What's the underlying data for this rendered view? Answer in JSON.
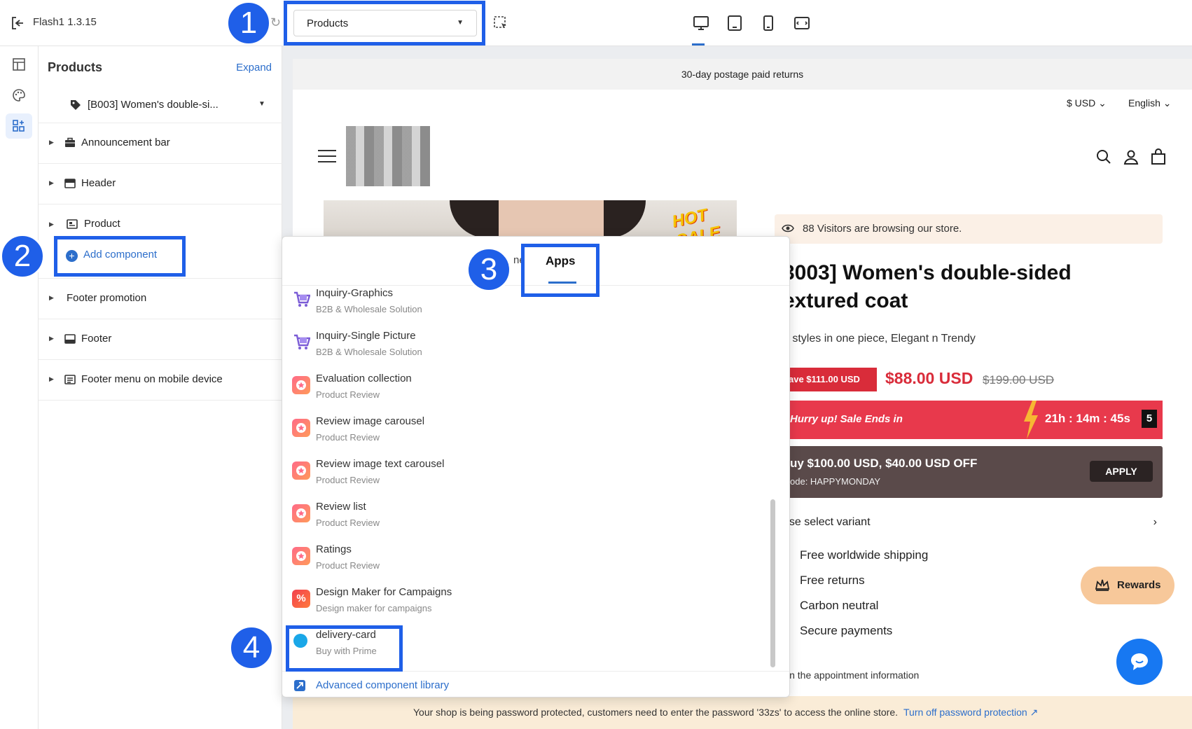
{
  "topbar": {
    "app_name": "Flash1  1.3.15",
    "page_select": "Products",
    "devices": [
      "desktop-icon",
      "tablet-icon",
      "mobile-icon",
      "fullscreen-icon"
    ]
  },
  "badges": [
    "1",
    "2",
    "3",
    "4"
  ],
  "panel": {
    "title": "Products",
    "expand": "Expand",
    "product_select": "[B003] Women's double-si...",
    "sections": [
      {
        "label": "Announcement bar"
      },
      {
        "label": "Header"
      },
      {
        "label": "Product"
      },
      {
        "label": "Footer promotion"
      },
      {
        "label": "Footer"
      },
      {
        "label": "Footer menu on mobile device"
      }
    ],
    "add_component": "Add component"
  },
  "popover": {
    "tab_partial": "ne",
    "tab_apps": "Apps",
    "items": [
      {
        "name": "Inquiry-Graphics",
        "sub": "B2B & Wholesale Solution"
      },
      {
        "name": "Inquiry-Single Picture",
        "sub": "B2B & Wholesale Solution"
      },
      {
        "name": "Evaluation collection",
        "sub": "Product Review"
      },
      {
        "name": "Review image carousel",
        "sub": "Product Review"
      },
      {
        "name": "Review image text carousel",
        "sub": "Product Review"
      },
      {
        "name": "Review list",
        "sub": "Product Review"
      },
      {
        "name": "Ratings",
        "sub": "Product Review"
      },
      {
        "name": "Design Maker for Campaigns",
        "sub": "Design maker for campaigns"
      },
      {
        "name": "delivery-card",
        "sub": "Buy with Prime"
      }
    ],
    "advanced": "Advanced component library"
  },
  "store": {
    "announcement": "30-day postage paid returns",
    "currency": "$ USD",
    "language": "English",
    "hot_sale": "HOT SALE",
    "visitors": "88 Visitors are browsing our store.",
    "title": "3003] Women's double-sided\nextured coat",
    "subtitle": "o styles in one piece, Elegant n Trendy",
    "save": "ave $111.00 USD",
    "price": "$88.00 USD",
    "old_price": "$199.00 USD",
    "hurry": "Hurry up! Sale Ends in",
    "countdown": "21h : 14m : 45s",
    "countdown_day": "5",
    "coupon_title": "uy $100.00 USD, $40.00 USD OFF",
    "coupon_code": "ode: HAPPYMONDAY",
    "apply": "APPLY",
    "variant": "ase select variant",
    "benefits": [
      "Free worldwide shipping",
      "Free returns",
      "Carbon neutral",
      "Secure payments"
    ],
    "appointment": "in the appointment information",
    "rewards": "Rewards",
    "password_notice": "Your shop is being password protected, customers need to enter the password '33zs' to access the online store.",
    "password_link": "Turn off password protection"
  },
  "colors": {
    "accent": "#2c6ecb",
    "badge": "#1f5fe8",
    "sale": "#d92c3a"
  }
}
